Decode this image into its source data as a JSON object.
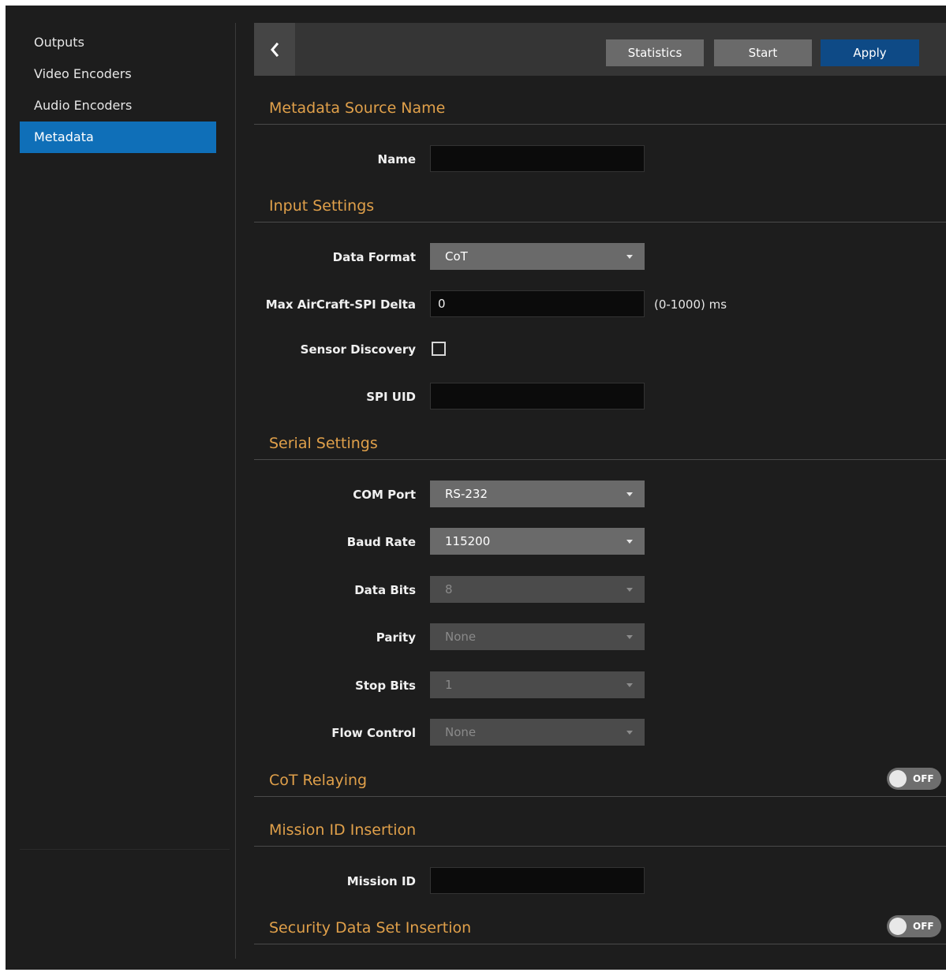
{
  "sidebar": {
    "items": [
      {
        "label": "Outputs"
      },
      {
        "label": "Video Encoders"
      },
      {
        "label": "Audio Encoders"
      },
      {
        "label": "Metadata",
        "active": true
      }
    ]
  },
  "toolbar": {
    "back_icon": "chevron-left-icon",
    "statistics_label": "Statistics",
    "start_label": "Start",
    "apply_label": "Apply"
  },
  "sections": {
    "source_name": {
      "title": "Metadata Source Name",
      "name_label": "Name",
      "name_value": ""
    },
    "input": {
      "title": "Input Settings",
      "data_format_label": "Data Format",
      "data_format_value": "CoT",
      "max_delta_label": "Max AirCraft-SPI Delta",
      "max_delta_value": "0",
      "max_delta_hint": "(0-1000) ms",
      "sensor_discovery_label": "Sensor Discovery",
      "sensor_discovery_checked": false,
      "spi_uid_label": "SPI UID",
      "spi_uid_value": ""
    },
    "serial": {
      "title": "Serial Settings",
      "com_port_label": "COM Port",
      "com_port_value": "RS-232",
      "baud_rate_label": "Baud Rate",
      "baud_rate_value": "115200",
      "data_bits_label": "Data Bits",
      "data_bits_value": "8",
      "parity_label": "Parity",
      "parity_value": "None",
      "stop_bits_label": "Stop Bits",
      "stop_bits_value": "1",
      "flow_control_label": "Flow Control",
      "flow_control_value": "None"
    },
    "cot_relaying": {
      "title": "CoT Relaying",
      "toggle_state": "OFF"
    },
    "mission_id": {
      "title": "Mission ID Insertion",
      "mission_id_label": "Mission ID",
      "mission_id_value": ""
    },
    "security": {
      "title": "Security Data Set Insertion",
      "toggle_state": "OFF"
    }
  },
  "colors": {
    "accent": "#e0a04a",
    "active_item": "#0f6fb8",
    "apply_button": "#0e4a86",
    "background": "#1d1d1d"
  }
}
